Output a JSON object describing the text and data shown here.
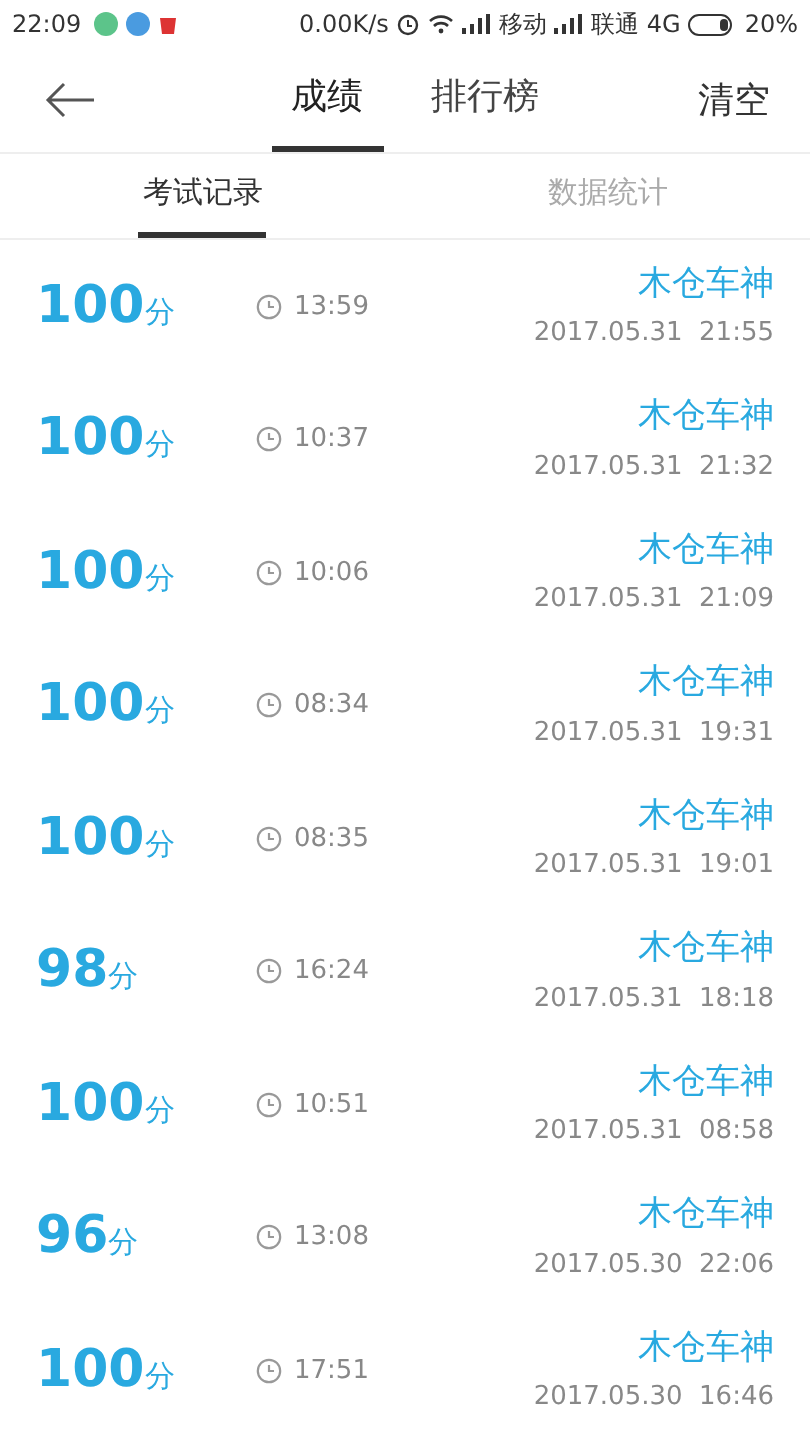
{
  "status_bar": {
    "time": "22:09",
    "speed": "0.00K/s",
    "carrier_1": "移动",
    "carrier_2": "联通",
    "network": "4G",
    "battery": "20%"
  },
  "header": {
    "action": "清空",
    "tabs": [
      {
        "label": "成绩",
        "selected": true
      },
      {
        "label": "排行榜",
        "selected": false
      }
    ]
  },
  "sub_tabs": [
    {
      "label": "考试记录",
      "selected": true
    },
    {
      "label": "数据统计",
      "selected": false
    }
  ],
  "records": [
    {
      "score": "100",
      "unit": "分",
      "duration": "13:59",
      "name": "木仓车神",
      "date": "2017.05.31  21:55"
    },
    {
      "score": "100",
      "unit": "分",
      "duration": "10:37",
      "name": "木仓车神",
      "date": "2017.05.31  21:32"
    },
    {
      "score": "100",
      "unit": "分",
      "duration": "10:06",
      "name": "木仓车神",
      "date": "2017.05.31  21:09"
    },
    {
      "score": "100",
      "unit": "分",
      "duration": "08:34",
      "name": "木仓车神",
      "date": "2017.05.31  19:31"
    },
    {
      "score": "100",
      "unit": "分",
      "duration": "08:35",
      "name": "木仓车神",
      "date": "2017.05.31  19:01"
    },
    {
      "score": "98",
      "unit": "分",
      "duration": "16:24",
      "name": "木仓车神",
      "date": "2017.05.31  18:18"
    },
    {
      "score": "100",
      "unit": "分",
      "duration": "10:51",
      "name": "木仓车神",
      "date": "2017.05.31  08:58"
    },
    {
      "score": "96",
      "unit": "分",
      "duration": "13:08",
      "name": "木仓车神",
      "date": "2017.05.30  22:06"
    },
    {
      "score": "100",
      "unit": "分",
      "duration": "17:51",
      "name": "木仓车神",
      "date": "2017.05.30  16:46"
    }
  ]
}
